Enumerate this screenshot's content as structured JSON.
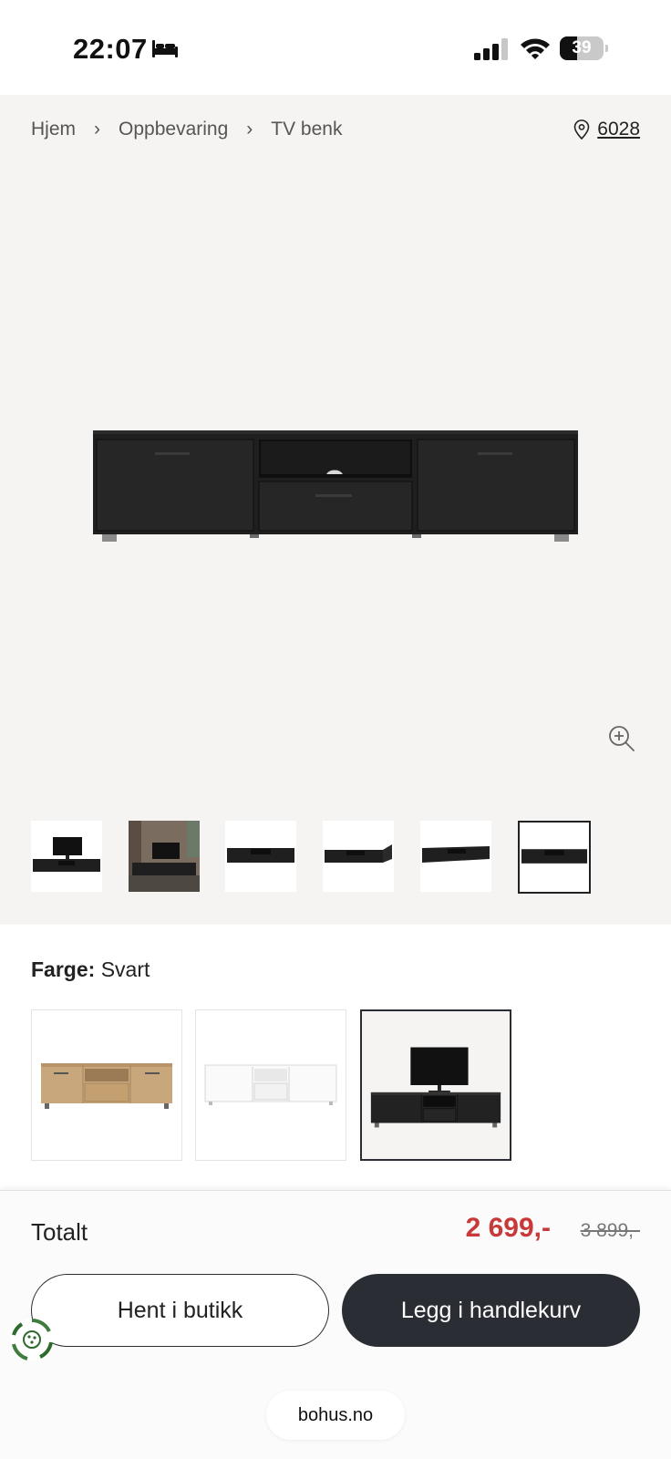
{
  "status_bar": {
    "time": "22:07",
    "battery_level": "39",
    "battery_fraction": 0.39,
    "icons": [
      "bed-icon",
      "cellular-signal-icon",
      "wifi-icon",
      "battery-icon"
    ]
  },
  "breadcrumb": {
    "items": [
      "Hjem",
      "Oppbevaring",
      "TV benk"
    ],
    "separator": "›"
  },
  "location": {
    "icon": "map-pin-icon",
    "code": "6028"
  },
  "gallery": {
    "product_image": "black-tv-bench",
    "zoom_icon": "zoom-in-icon",
    "thumbnails": [
      {
        "image": "tv-bench-with-tv",
        "active": false
      },
      {
        "image": "tv-bench-room-photo",
        "active": false
      },
      {
        "image": "tv-bench-front",
        "active": false
      },
      {
        "image": "tv-bench-doors-open",
        "active": false
      },
      {
        "image": "tv-bench-angle",
        "active": false
      },
      {
        "image": "tv-bench-front-selected",
        "active": true
      }
    ]
  },
  "color_selector": {
    "label": "Farge:",
    "value": "Svart",
    "options": [
      {
        "image": "oak-tv-bench",
        "selected": false
      },
      {
        "image": "white-tv-bench",
        "selected": false
      },
      {
        "image": "black-tv-bench-with-tv",
        "selected": true
      }
    ]
  },
  "purchase": {
    "total_label": "Totalt",
    "price": "2 699,-",
    "price_before": "3 899,-",
    "store_button": "Hent i butikk",
    "cart_button": "Legg i handlekurv"
  },
  "browser": {
    "url": "bohus.no"
  },
  "colors": {
    "sale_price": "#c83a3a",
    "primary_button": "#2a2d33",
    "gallery_background": "#f5f4f2"
  }
}
